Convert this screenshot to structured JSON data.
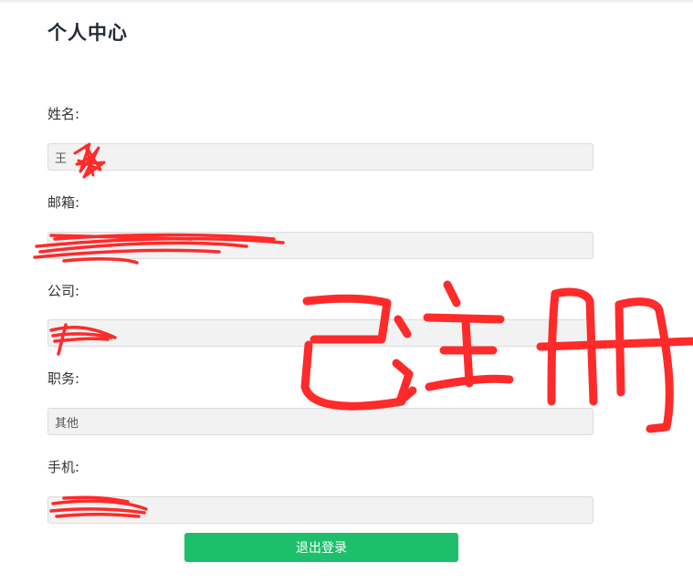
{
  "page": {
    "title": "个人中心"
  },
  "form": {
    "name_label": "姓名:",
    "name_value": "王",
    "email_label": "邮箱:",
    "email_value": "",
    "company_label": "公司:",
    "company_value": "",
    "position_label": "职务:",
    "position_value": "其他",
    "phone_label": "手机:",
    "phone_value": ""
  },
  "actions": {
    "logout_label": "退出登录"
  },
  "annotation": {
    "stamp_text": "已注册",
    "color": "#ff2a2a"
  },
  "colors": {
    "button_green": "#1dbf6a",
    "input_bg": "#f2f2f2"
  }
}
